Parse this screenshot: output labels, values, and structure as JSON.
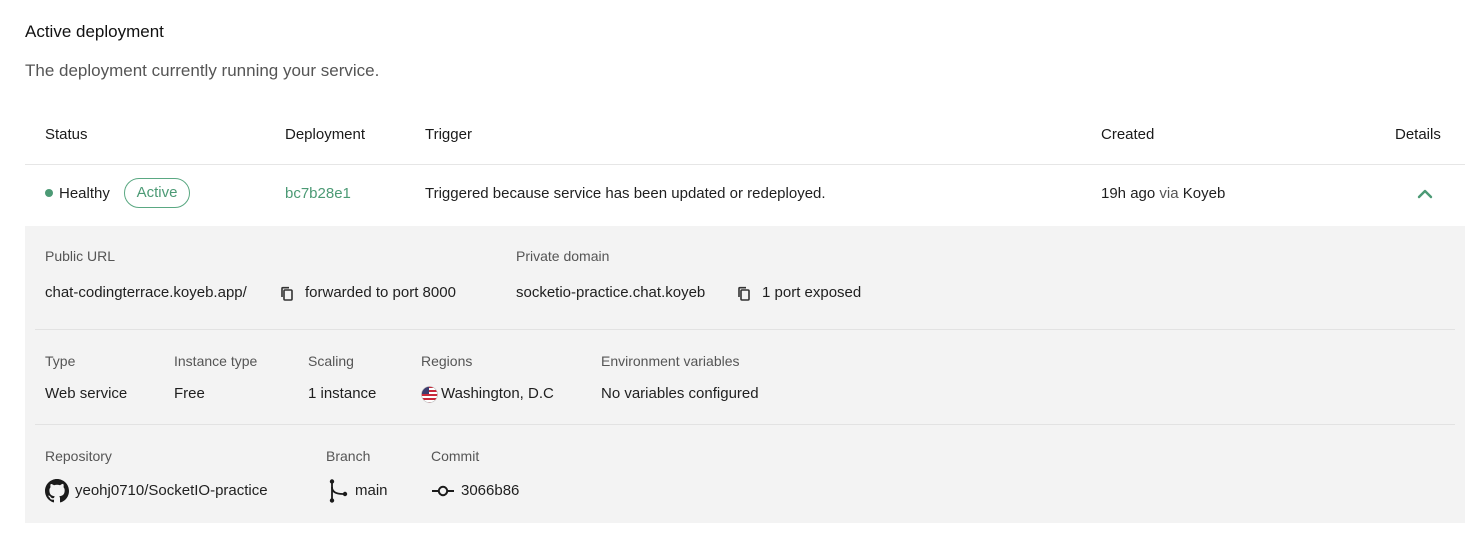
{
  "section": {
    "title": "Active deployment",
    "subtitle": "The deployment currently running your service."
  },
  "table": {
    "headers": [
      "Status",
      "Deployment",
      "Trigger",
      "Created",
      "Details"
    ],
    "row": {
      "status": "Healthy",
      "status_color": "#4c9a75",
      "badge": "Active",
      "deployment_id": "bc7b28e1",
      "trigger": "Triggered because service has been updated or redeployed.",
      "created_ago": "19h ago",
      "created_via_label": "via",
      "created_via": "Koyeb",
      "details_icon": "chevron-up-icon"
    }
  },
  "details": {
    "public_url": {
      "label": "Public URL",
      "url": "chat-codingterrace.koyeb.app/",
      "copy_icon": "copy-icon",
      "forward_text": "forwarded to port 8000"
    },
    "private_domain": {
      "label": "Private domain",
      "domain": "socketio-practice.chat.koyeb",
      "copy_icon": "copy-icon",
      "ports_text": "1 port exposed"
    },
    "type": {
      "label": "Type",
      "value": "Web service"
    },
    "instance_type": {
      "label": "Instance type",
      "value": "Free"
    },
    "scaling": {
      "label": "Scaling",
      "value": "1 instance"
    },
    "regions": {
      "label": "Regions",
      "value": "Washington, D.C",
      "flag_icon": "us-flag-icon"
    },
    "env": {
      "label": "Environment variables",
      "value": "No variables configured"
    },
    "repository": {
      "label": "Repository",
      "value": "yeohj0710/SocketIO-practice",
      "icon": "github-icon"
    },
    "branch": {
      "label": "Branch",
      "value": "main",
      "icon": "git-branch-icon"
    },
    "commit": {
      "label": "Commit",
      "value": "3066b86",
      "icon": "git-commit-icon"
    }
  },
  "colors": {
    "accent_green": "#4c9a75",
    "panel_bg": "#f3f3f3"
  }
}
